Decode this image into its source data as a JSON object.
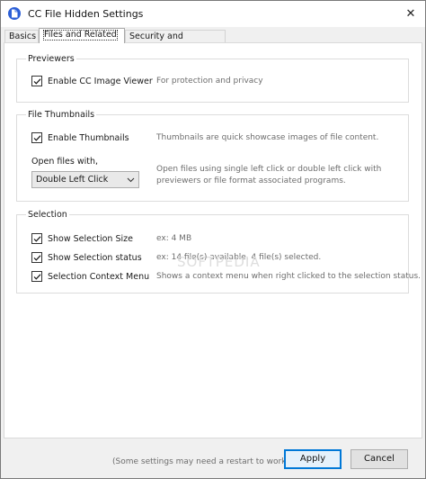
{
  "window": {
    "title": "CC File Hidden Settings",
    "close_glyph": "✕"
  },
  "tabs": [
    {
      "label": "Basics",
      "active": false
    },
    {
      "label": "Files and Related",
      "active": true
    },
    {
      "label": "Security and Emergency",
      "active": false
    }
  ],
  "previewers": {
    "title": "Previewers",
    "items": [
      {
        "label": "Enable CC Image Viewer",
        "checked": true,
        "description": "For protection and privacy"
      }
    ]
  },
  "thumbnails": {
    "title": "File Thumbnails",
    "enable": {
      "label": "Enable Thumbnails",
      "checked": true,
      "description": "Thumbnails are quick showcase images of file content."
    },
    "open_with": {
      "label": "Open files with,",
      "selected": "Double Left Click",
      "description_line1": "Open files using single left click or double left click with",
      "description_line2": "previewers or file format associated programs."
    }
  },
  "selection": {
    "title": "Selection",
    "items": [
      {
        "label": "Show Selection Size",
        "checked": true,
        "description": "ex: 4 MB"
      },
      {
        "label": "Show Selection status",
        "checked": true,
        "description": "ex: 14 file(s) available, 4 file(s) selected."
      },
      {
        "label": "Selection Context Menu",
        "checked": true,
        "description": "Shows a context menu when right clicked to the selection status."
      }
    ]
  },
  "footer": {
    "note": "(Some settings may need a restart to work)",
    "apply_label": "Apply",
    "cancel_label": "Cancel"
  },
  "watermark": "SOFTPEDIA",
  "colors": {
    "accent": "#0078d7",
    "app_icon": "#2c5fd6",
    "description_text": "#6d6d6d"
  },
  "icons": {
    "app": "document-icon",
    "close": "close-icon",
    "check": "check-icon",
    "dropdown": "chevron-down-icon"
  }
}
